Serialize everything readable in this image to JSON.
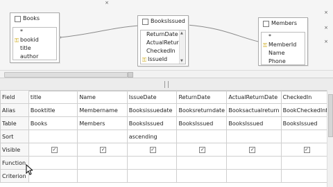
{
  "tables": {
    "books": {
      "title": "Books",
      "fields": [
        "*",
        "bookid",
        "title",
        "author"
      ]
    },
    "booksissued": {
      "title": "BooksIssued",
      "fields": [
        "ReturnDate",
        "ActualRetur",
        "CheckedIn",
        "IssueId"
      ]
    },
    "members": {
      "title": "Members",
      "fields": [
        "*",
        "MemberId",
        "Name",
        "Phone"
      ]
    }
  },
  "grid": {
    "row_labels": [
      "Field",
      "Alias",
      "Table",
      "Sort",
      "Visible",
      "Function",
      "Criterion"
    ],
    "columns": [
      {
        "field": "title",
        "alias": "Booktitle",
        "table": "Books",
        "sort": "",
        "visible": true
      },
      {
        "field": "Name",
        "alias": "Membername",
        "table": "Members",
        "sort": "",
        "visible": true
      },
      {
        "field": "IssueDate",
        "alias": "Booksissuedate",
        "table": "BooksIssued",
        "sort": "ascending",
        "visible": true
      },
      {
        "field": "ReturnDate",
        "alias": "Booksreturndate",
        "table": "BooksIssued",
        "sort": "",
        "visible": true
      },
      {
        "field": "ActualReturnDate",
        "alias": "Booksactualreturn",
        "table": "BooksIssued",
        "sort": "",
        "visible": true
      },
      {
        "field": "CheckedIn",
        "alias": "BookCheckedInfo",
        "table": "BooksIssued",
        "sort": "",
        "visible": true
      }
    ]
  },
  "checkmark": "✓"
}
